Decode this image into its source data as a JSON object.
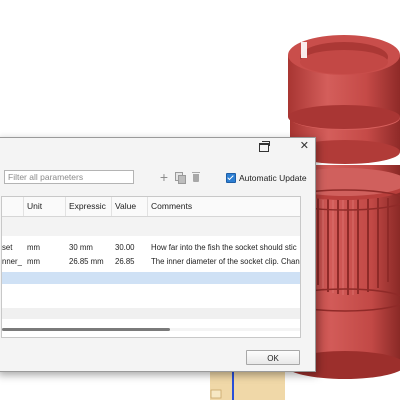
{
  "dialog": {
    "toolbar": {
      "filter_placeholder": "Filter all parameters",
      "auto_update_label": "Automatic Update",
      "auto_update_checked": true
    },
    "table": {
      "columns": [
        "",
        "Unit",
        "Expressic",
        "Value",
        "Comments"
      ],
      "rows": [
        {
          "name": "set",
          "unit": "mm",
          "expression": "30 mm",
          "value": "30.00",
          "comment": "How far into the fish the socket should stic"
        },
        {
          "name": "nner_",
          "unit": "mm",
          "expression": "26.85 mm",
          "value": "26.85",
          "comment": "The inner diameter of the socket clip. Chan"
        }
      ]
    },
    "ok_label": "OK"
  },
  "colors": {
    "model_body": "#c94e4b",
    "model_dark": "#9c2f2c",
    "selection": "#cfe1f5",
    "checkbox": "#2d7fd3"
  }
}
